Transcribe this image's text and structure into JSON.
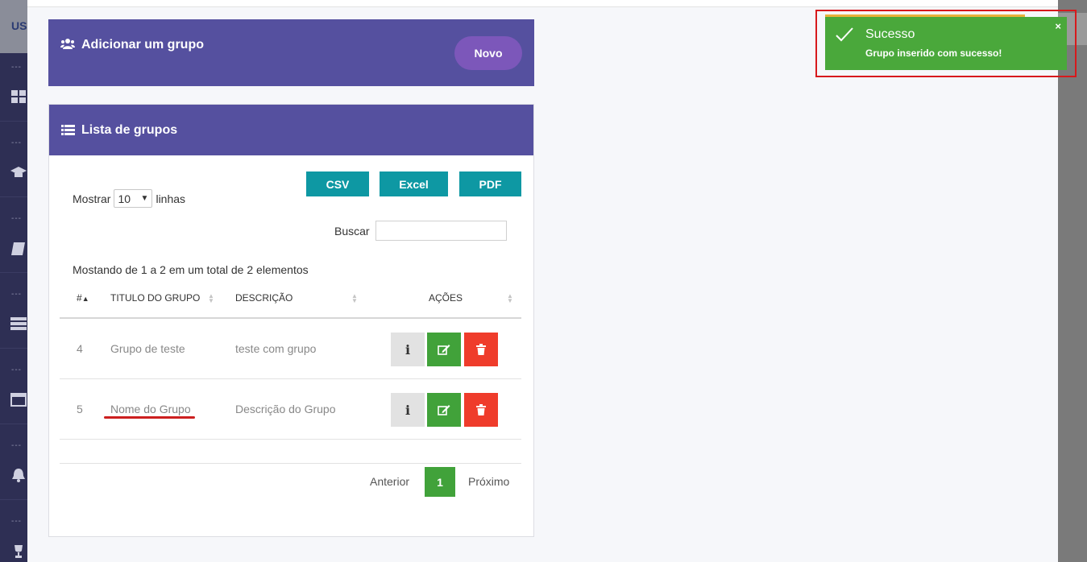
{
  "sidebar": {
    "logo": "US",
    "items": [
      {
        "icon": "dashboard-icon"
      },
      {
        "icon": "graduation-cap-icon"
      },
      {
        "icon": "book-icon"
      },
      {
        "icon": "list-icon"
      },
      {
        "icon": "calendar-icon"
      },
      {
        "icon": "bell-icon"
      },
      {
        "icon": "trophy-icon"
      }
    ],
    "dots": "---"
  },
  "add_group": {
    "title": "Adicionar um grupo",
    "new_button": "Novo"
  },
  "group_list": {
    "title": "Lista de grupos",
    "export": {
      "csv": "CSV",
      "excel": "Excel",
      "pdf": "PDF"
    },
    "show_prefix": "Mostrar",
    "show_value": "10",
    "show_suffix": "linhas",
    "search_label": "Buscar",
    "search_value": "",
    "info": "Mostando de 1 a 2 em um total de 2 elementos",
    "columns": {
      "id": "#",
      "title": "TITULO DO GRUPO",
      "description": "DESCRIÇÃO",
      "actions": "AÇÕES"
    },
    "rows": [
      {
        "id": "4",
        "title": "Grupo de teste",
        "description": "teste com grupo"
      },
      {
        "id": "5",
        "title": "Nome do Grupo",
        "description": "Descrição do Grupo"
      }
    ],
    "pagination": {
      "prev": "Anterior",
      "current": "1",
      "next": "Próximo"
    }
  },
  "toast": {
    "title": "Sucesso",
    "message": "Grupo inserido com sucesso!",
    "close": "×"
  },
  "colors": {
    "header": "#55509f",
    "new_button": "#7c57ba",
    "export": "#0e98a3",
    "success": "#4aa83b",
    "danger": "#ef3c2b",
    "highlight": "#d7191c"
  }
}
